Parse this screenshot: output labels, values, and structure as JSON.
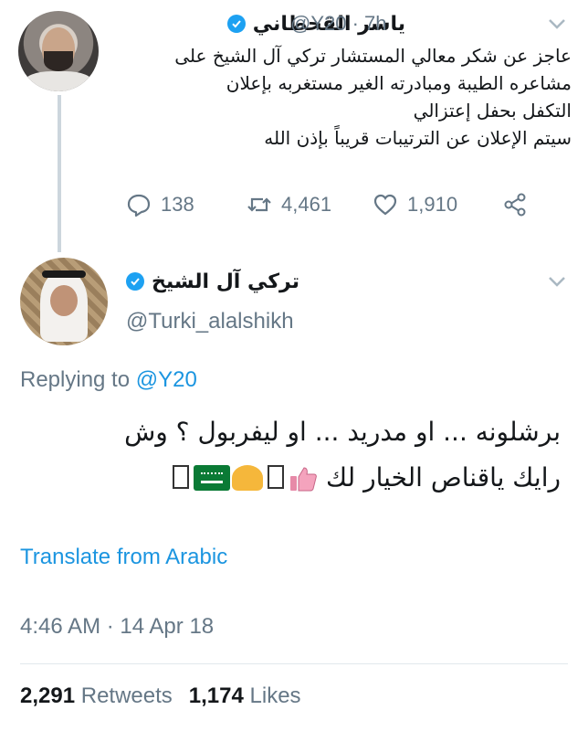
{
  "tweet1": {
    "name": "ياسر القحطاني",
    "handle": "@Y20 · 7h",
    "text_lines": [
      "عاجز عن شكر معالي المستشار تركي آل الشيخ على",
      "مشاعره الطيبة ومبادرته الغير مستغربه بإعلان",
      "التكفل بحفل إعتزالي",
      "سيتم الإعلان عن الترتيبات قريباً بإذن الله"
    ],
    "replies": "138",
    "retweets": "4,461",
    "likes": "1,910"
  },
  "tweet2": {
    "name": "تركي آل الشيخ",
    "handle": "@Turki_alalshikh",
    "replying_prefix": "Replying to",
    "replying_to": "@Y20",
    "text_line1": "برشلونه ... او مدريد ... او ليفربول ؟ وش",
    "text_line2": "رايك ياقناص الخيار لك",
    "translate": "Translate from Arabic",
    "timestamp": "4:46 AM · 14 Apr 18",
    "retweets_count": "2,291",
    "retweets_label": "Retweets",
    "likes_count": "1,174",
    "likes_label": "Likes"
  },
  "colors": {
    "link": "#1b95e0",
    "verified": "#1da1f2",
    "muted": "#657786",
    "text": "#14171a"
  },
  "icons": [
    "reply-icon",
    "retweet-icon",
    "like-icon",
    "share-icon",
    "verified-icon",
    "chevron-down-icon"
  ]
}
